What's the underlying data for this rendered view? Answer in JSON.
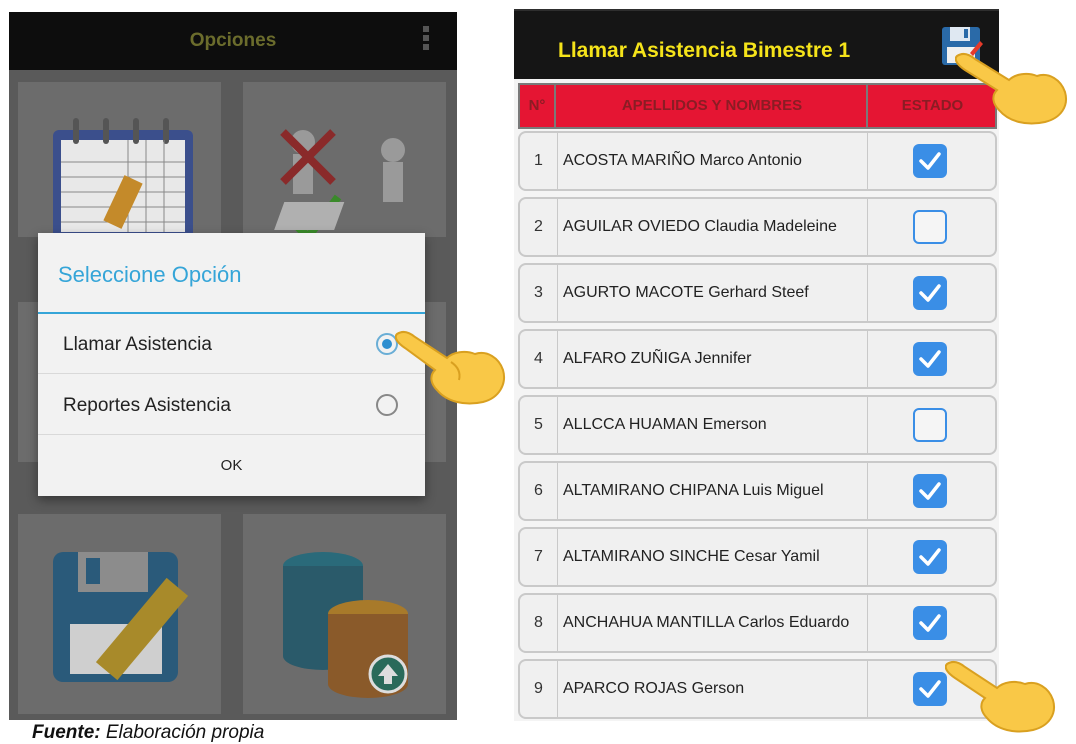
{
  "left_screen": {
    "title": "Opciones",
    "dialog": {
      "title": "Seleccione Opción",
      "options": [
        {
          "label": "Llamar Asistencia",
          "selected": true
        },
        {
          "label": "Reportes Asistencia",
          "selected": false
        }
      ],
      "ok_label": "OK"
    }
  },
  "right_screen": {
    "title": "Llamar Asistencia Bimestre 1",
    "headers": {
      "num": "N°",
      "name": "APELLIDOS Y NOMBRES",
      "status": "ESTADO"
    },
    "rows": [
      {
        "num": "1",
        "name": "ACOSTA MARIÑO  Marco Antonio",
        "checked": true
      },
      {
        "num": "2",
        "name": "AGUILAR OVIEDO  Claudia Madeleine",
        "checked": false
      },
      {
        "num": "3",
        "name": "AGURTO MACOTE  Gerhard Steef",
        "checked": true
      },
      {
        "num": "4",
        "name": "ALFARO ZUÑIGA  Jennifer",
        "checked": true
      },
      {
        "num": "5",
        "name": "ALLCCA HUAMAN  Emerson",
        "checked": false
      },
      {
        "num": "6",
        "name": "ALTAMIRANO CHIPANA  Luis Miguel",
        "checked": true
      },
      {
        "num": "7",
        "name": "ALTAMIRANO SINCHE  Cesar Yamil",
        "checked": true
      },
      {
        "num": "8",
        "name": "ANCHAHUA MANTILLA  Carlos Eduardo",
        "checked": true
      },
      {
        "num": "9",
        "name": "APARCO ROJAS  Gerson",
        "checked": true
      }
    ]
  },
  "caption": {
    "bold": "Fuente:",
    "text": " Elaboración propia"
  },
  "colors": {
    "accent": "#35a5d8",
    "header_red": "#e51533",
    "title_yellow": "#f5e31a",
    "checkbox_blue": "#3a8ee6"
  }
}
